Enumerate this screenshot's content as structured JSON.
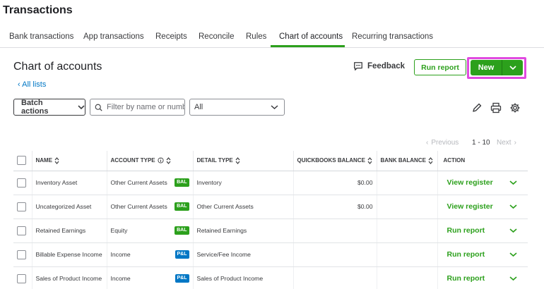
{
  "app": {
    "title": "Transactions"
  },
  "tabs": [
    {
      "label": "Bank transactions"
    },
    {
      "label": "App transactions"
    },
    {
      "label": "Receipts"
    },
    {
      "label": "Reconcile"
    },
    {
      "label": "Rules"
    },
    {
      "label": "Chart of accounts",
      "active": true
    },
    {
      "label": "Recurring transactions"
    }
  ],
  "page": {
    "title": "Chart of accounts",
    "back_link": "All lists",
    "feedback_label": "Feedback",
    "run_report_label": "Run report",
    "new_label": "New"
  },
  "toolbar": {
    "batch_actions_label": "Batch actions",
    "filter_placeholder": "Filter by name or number",
    "type_select_value": "All"
  },
  "pager": {
    "previous_label": "Previous",
    "range": "1 - 10",
    "next_label": "Next"
  },
  "table": {
    "headers": {
      "name": "NAME",
      "account_type": "ACCOUNT TYPE",
      "detail_type": "DETAIL TYPE",
      "qb_balance": "QUICKBOOKS BALANCE",
      "bank_balance": "BANK BALANCE",
      "action": "ACTION"
    },
    "rows": [
      {
        "name": "Inventory Asset",
        "account_type": "Other Current Assets",
        "badge": "BAL",
        "detail_type": "Inventory",
        "qb_balance": "$0.00",
        "bank_balance": "",
        "action": "View register"
      },
      {
        "name": "Uncategorized Asset",
        "account_type": "Other Current Assets",
        "badge": "BAL",
        "detail_type": "Other Current Assets",
        "qb_balance": "$0.00",
        "bank_balance": "",
        "action": "View register"
      },
      {
        "name": "Retained Earnings",
        "account_type": "Equity",
        "badge": "BAL",
        "detail_type": "Retained Earnings",
        "qb_balance": "",
        "bank_balance": "",
        "action": "Run report"
      },
      {
        "name": "Billable Expense Income",
        "account_type": "Income",
        "badge": "P&L",
        "detail_type": "Service/Fee Income",
        "qb_balance": "",
        "bank_balance": "",
        "action": "Run report"
      },
      {
        "name": "Sales of Product Income",
        "account_type": "Income",
        "badge": "P&L",
        "detail_type": "Sales of Product Income",
        "qb_balance": "",
        "bank_balance": "",
        "action": "Run report"
      }
    ]
  },
  "colors": {
    "accent_green": "#2ca01c",
    "link_blue": "#0077c5",
    "highlight_magenta": "#e04ae0"
  },
  "icons": {
    "feedback": "chat-bubble-icon",
    "back": "chevron-left-icon",
    "new_dropdown": "chevron-down-icon",
    "search": "search-icon",
    "edit": "pencil-icon",
    "print": "printer-icon",
    "settings": "gear-icon",
    "sort": "sort-icon",
    "info": "info-icon"
  }
}
